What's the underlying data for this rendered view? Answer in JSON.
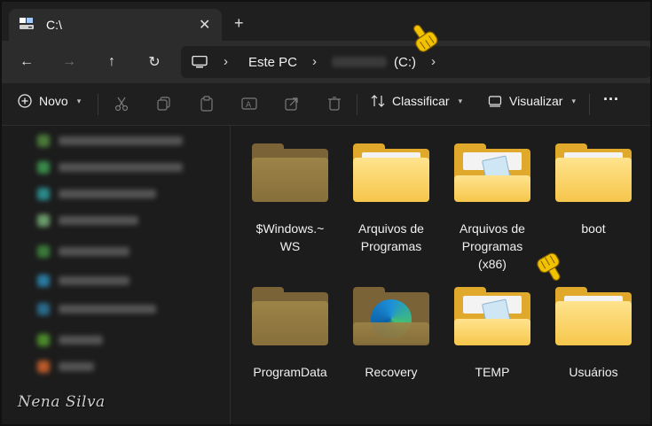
{
  "tab": {
    "title": "C:\\",
    "close": "✕",
    "new": "+"
  },
  "nav": {
    "back": "←",
    "forward": "→",
    "up": "↑",
    "refresh": "↻"
  },
  "address": {
    "crumbs": [
      "Este PC",
      "(C:)"
    ],
    "sep": "›"
  },
  "commands": {
    "new_label": "Novo",
    "sort_label": "Classificar",
    "view_label": "Visualizar",
    "more_label": "···"
  },
  "folders": [
    {
      "label": "$Windows.~\nWS",
      "style": "hidden"
    },
    {
      "label": "Arquivos de\nProgramas",
      "style": "normal"
    },
    {
      "label": "Arquivos de\nProgramas\n(x86)",
      "style": "normal-doc"
    },
    {
      "label": "boot",
      "style": "normal"
    },
    {
      "label": "ProgramData",
      "style": "hidden"
    },
    {
      "label": "Recovery",
      "style": "hidden-edge"
    },
    {
      "label": "TEMP",
      "style": "normal-doc"
    },
    {
      "label": "Usuários",
      "style": "normal"
    }
  ],
  "watermark": "Nena Silva",
  "colors": {
    "folder": "#f6c64b",
    "folder_hidden": "#876f3b",
    "background": "#1c1c1c",
    "pointer": "#f2c200"
  }
}
